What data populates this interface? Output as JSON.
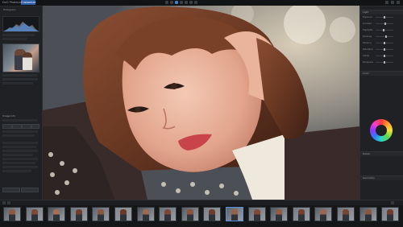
{
  "app": {
    "brand": "DxO PhotoLab",
    "tabs": [
      "Library",
      "Customize"
    ],
    "active_tab_index": 1,
    "accent": "#2c5ea8"
  },
  "left_panel": {
    "histogram_title": "Histogram",
    "thumb_label": "",
    "rows": [
      "",
      "",
      ""
    ],
    "section_title": "Image Info"
  },
  "right_panel": {
    "sections": [
      "Light",
      "Color",
      "Detail",
      "Geometry"
    ],
    "sliders": [
      {
        "label": "Exposure",
        "value": 0.5
      },
      {
        "label": "Contrast",
        "value": 0.55
      },
      {
        "label": "Highlights",
        "value": 0.45
      },
      {
        "label": "Shadows",
        "value": 0.6
      },
      {
        "label": "Vibrancy",
        "value": 0.5
      },
      {
        "label": "Saturation",
        "value": 0.52
      },
      {
        "label": "Clarity",
        "value": 0.5
      },
      {
        "label": "Sharpness",
        "value": 0.48
      }
    ]
  },
  "filmstrip": {
    "count_label": "",
    "thumbnails": [
      {
        "caption": "",
        "selected": false
      },
      {
        "caption": "",
        "selected": false
      },
      {
        "caption": "",
        "selected": false
      },
      {
        "caption": "",
        "selected": false
      },
      {
        "caption": "",
        "selected": false
      },
      {
        "caption": "",
        "selected": false
      },
      {
        "caption": "",
        "selected": false
      },
      {
        "caption": "",
        "selected": false
      },
      {
        "caption": "",
        "selected": false
      },
      {
        "caption": "",
        "selected": false
      },
      {
        "caption": "",
        "selected": true
      },
      {
        "caption": "",
        "selected": false
      },
      {
        "caption": "",
        "selected": false
      },
      {
        "caption": "",
        "selected": false
      },
      {
        "caption": "",
        "selected": false
      },
      {
        "caption": "",
        "selected": false
      },
      {
        "caption": "",
        "selected": false
      },
      {
        "caption": "",
        "selected": false
      }
    ]
  },
  "icons": [
    "undo-icon",
    "redo-icon",
    "compare-icon",
    "crop-icon",
    "brush-icon",
    "zoom-icon",
    "fullscreen-icon"
  ]
}
